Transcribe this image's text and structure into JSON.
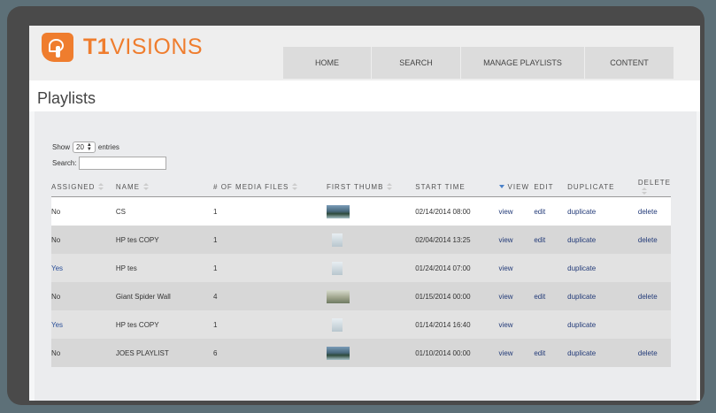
{
  "header": {
    "logo_t1": "T1",
    "logo_rest": "VISIONS",
    "nav": [
      "HOME",
      "SEARCH",
      "MANAGE PLAYLISTS",
      "CONTENT"
    ]
  },
  "page_title": "Playlists",
  "controls": {
    "show_label": "Show",
    "entries_value": "20",
    "entries_label": "entries",
    "search_label": "Search:"
  },
  "table": {
    "columns": [
      "ASSIGNED",
      "NAME",
      "# OF MEDIA FILES",
      "FIRST THUMB",
      "START TIME",
      "VIEW",
      "EDIT",
      "DUPLICATE",
      "DELETE"
    ],
    "rows": [
      {
        "assigned": "No",
        "name": "CS",
        "files": "1",
        "thumb": "landscape-thumbnail",
        "start": "02/14/2014 08:00",
        "view": "view",
        "edit": "edit",
        "duplicate": "duplicate",
        "delete": "delete"
      },
      {
        "assigned": "No",
        "name": "HP tes COPY",
        "files": "1",
        "thumb": "blank-thumbnail",
        "start": "02/04/2014 13:25",
        "view": "view",
        "edit": "edit",
        "duplicate": "duplicate",
        "delete": "delete"
      },
      {
        "assigned": "Yes",
        "name": "HP tes",
        "files": "1",
        "thumb": "blank-thumbnail",
        "start": "01/24/2014 07:00",
        "view": "view",
        "edit": "",
        "duplicate": "duplicate",
        "delete": ""
      },
      {
        "assigned": "No",
        "name": "Giant Spider Wall",
        "files": "4",
        "thumb": "wall-thumbnail",
        "start": "01/15/2014 00:00",
        "view": "view",
        "edit": "edit",
        "duplicate": "duplicate",
        "delete": "delete"
      },
      {
        "assigned": "Yes",
        "name": "HP tes COPY",
        "files": "1",
        "thumb": "blank-thumbnail",
        "start": "01/14/2014 16:40",
        "view": "view",
        "edit": "",
        "duplicate": "duplicate",
        "delete": ""
      },
      {
        "assigned": "No",
        "name": "JOES PLAYLIST",
        "files": "6",
        "thumb": "landscape-thumbnail",
        "start": "01/10/2014 00:00",
        "view": "view",
        "edit": "edit",
        "duplicate": "duplicate",
        "delete": "delete"
      }
    ]
  },
  "colors": {
    "brand": "#ef7d2e",
    "frame": "#4a4a4a",
    "yes": "#2a4f99"
  }
}
